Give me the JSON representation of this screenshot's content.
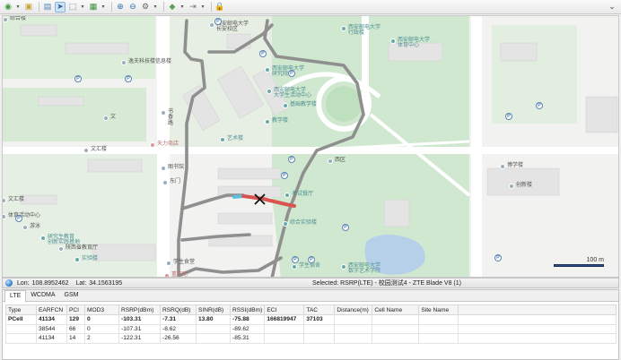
{
  "toolbar": {
    "buttons": [
      {
        "name": "layer-icon",
        "dropdown": true
      },
      {
        "name": "open-icon",
        "dropdown": false
      },
      {
        "name": "map-icon",
        "dropdown": false
      },
      {
        "name": "select-arrow-icon",
        "dropdown": false,
        "active": true
      },
      {
        "name": "select-area-icon",
        "dropdown": true
      },
      {
        "name": "grid-icon",
        "dropdown": true
      },
      {
        "name": "zoom-in-icon",
        "dropdown": false
      },
      {
        "name": "zoom-out-icon",
        "dropdown": false
      },
      {
        "name": "settings-icon",
        "dropdown": true
      },
      {
        "name": "tag-icon",
        "dropdown": true
      },
      {
        "name": "measure-icon",
        "dropdown": true
      },
      {
        "name": "lock-icon",
        "dropdown": false
      }
    ]
  },
  "map": {
    "labels": [
      {
        "text": "综合楼",
        "cls": "dark"
      },
      {
        "text": "西安邮电大学\n长安校区",
        "cls": "dark"
      },
      {
        "text": "西安邮电大学\n行政楼",
        "cls": "teal"
      },
      {
        "text": "逸夫科技楼信息楼",
        "cls": "dark"
      },
      {
        "text": "西安邮电大学\n体育中心",
        "cls": "teal"
      },
      {
        "text": "西安邮电大学\n研究院",
        "cls": "teal"
      },
      {
        "text": "西安邮电大学\n大学生活动中心",
        "cls": "teal"
      },
      {
        "text": "基础教学楼",
        "cls": "teal"
      },
      {
        "text": "教学楼",
        "cls": "teal"
      },
      {
        "text": "艺术楼",
        "cls": "teal"
      },
      {
        "text": "书\n香\n路",
        "cls": "dark"
      },
      {
        "text": "天力商店",
        "cls": "red"
      },
      {
        "text": "文汇楼",
        "cls": "dark"
      },
      {
        "text": "图书馆",
        "cls": "dark"
      },
      {
        "text": "西区",
        "cls": "dark"
      },
      {
        "text": "考试餐厅",
        "cls": "teal"
      },
      {
        "text": "东门",
        "cls": "dark"
      },
      {
        "text": "综合实验楼",
        "cls": "teal"
      },
      {
        "text": "研究生教育\n创新实践基地",
        "cls": "teal"
      },
      {
        "text": "实验楼",
        "cls": "teal"
      },
      {
        "text": "学生食堂",
        "cls": "dark"
      },
      {
        "text": "学生宿舍",
        "cls": "teal"
      },
      {
        "text": "西安邮电大学\n数字艺术学院",
        "cls": "teal"
      },
      {
        "text": "文汇楼",
        "cls": "dark"
      },
      {
        "text": "体育活动中心",
        "cls": "dark"
      },
      {
        "text": "陕西省教育厅",
        "cls": "dark"
      },
      {
        "text": "重庆吧",
        "cls": "red"
      },
      {
        "text": "游泳",
        "cls": "dark"
      },
      {
        "text": "博学楼",
        "cls": "dark"
      },
      {
        "text": "创新楼",
        "cls": "dark"
      },
      {
        "text": "文",
        "cls": "dark"
      }
    ],
    "parking_symbol": "P",
    "scale_text": "100 m"
  },
  "status": {
    "lon_label": "Lon:",
    "lon_value": "108.8952462",
    "lat_label": "Lat:",
    "lat_value": "34.1563195",
    "selected": "Selected: RSRP(LTE) - 校园测试4 - ZTE Blade V8 (1)"
  },
  "tabs": [
    "LTE",
    "WCDMA",
    "GSM"
  ],
  "active_tab": "LTE",
  "table": {
    "columns": [
      "Type",
      "EARFCN",
      "PCI",
      "MOD3",
      "RSRP(dBm)",
      "RSRQ(dB)",
      "SINR(dB)",
      "RSSI(dBm)",
      "ECI",
      "TAC",
      "Distance(m)",
      "Cell Name",
      "Site Name",
      ""
    ],
    "rows": [
      {
        "cells": [
          "PCell",
          "41134",
          "129",
          "0",
          "-103.31",
          "-7.31",
          "13.80",
          "-75.88",
          "166819947",
          "37103",
          "",
          "",
          "",
          ""
        ],
        "bold": true
      },
      {
        "cells": [
          "",
          "38544",
          "66",
          "0",
          "-107.31",
          "-8.62",
          "",
          "-89.62",
          "",
          "",
          "",
          "",
          "",
          ""
        ],
        "bold": false
      },
      {
        "cells": [
          "",
          "41134",
          "14",
          "2",
          "-122.31",
          "-26.56",
          "",
          "-85.31",
          "",
          "",
          "",
          "",
          "",
          ""
        ],
        "bold": false
      }
    ]
  },
  "colors": {
    "track_gray": "#8f8f8f",
    "track_red": "#d9534f",
    "track_blue": "#5bc0de",
    "green_area": "#cfe8cf",
    "water": "#b7d0ea"
  }
}
